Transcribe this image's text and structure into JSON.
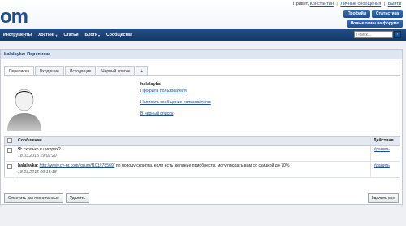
{
  "header": {
    "logo": "om",
    "greeting": "Привет,",
    "username": "Константин",
    "messages_link": "Личные сообщения",
    "logout_link": "Выйти",
    "buttons": [
      "Профайл",
      "Статистика"
    ],
    "new_topics": "Новые темы на форуме"
  },
  "nav": {
    "items": [
      "Инструменты",
      "Хостинг",
      "Статьи",
      "Блоги",
      "Сообщества"
    ],
    "search_placeholder": "Поиск..."
  },
  "breadcrumb": "balalayka: Переписка",
  "tabs": [
    "Переписка",
    "Входящие",
    "Исходящие",
    "Черный список",
    "+"
  ],
  "profile": {
    "name": "balalayka",
    "links": [
      "Профиль пользователя",
      "Написать сообщение пользователю",
      "В черный список"
    ]
  },
  "table": {
    "headers": [
      "Сообщение",
      "Действия"
    ],
    "rows": [
      {
        "author": "Я:",
        "text": "сколько в цифрах?",
        "link": "",
        "text_after": "",
        "date": "18.03.2015 19:02:20",
        "action": "Удалить"
      },
      {
        "author": "balalayka:",
        "text": "",
        "link": "http://www.cy-pr.com/forum/f101/t78569/",
        "text_after": "по поводу скрипта, если есть желание приобрести, могу продать вам со скидкой до 70%",
        "date": "18.03.2015 09:15:18",
        "action": "Удалить"
      }
    ]
  },
  "footer": {
    "mark_read": "Отметить как прочитанные",
    "delete": "Удалить",
    "delete_all": "Удалить все"
  },
  "colors": {
    "brand": "#1d4f8c",
    "nav_bg": "#1f4476"
  }
}
